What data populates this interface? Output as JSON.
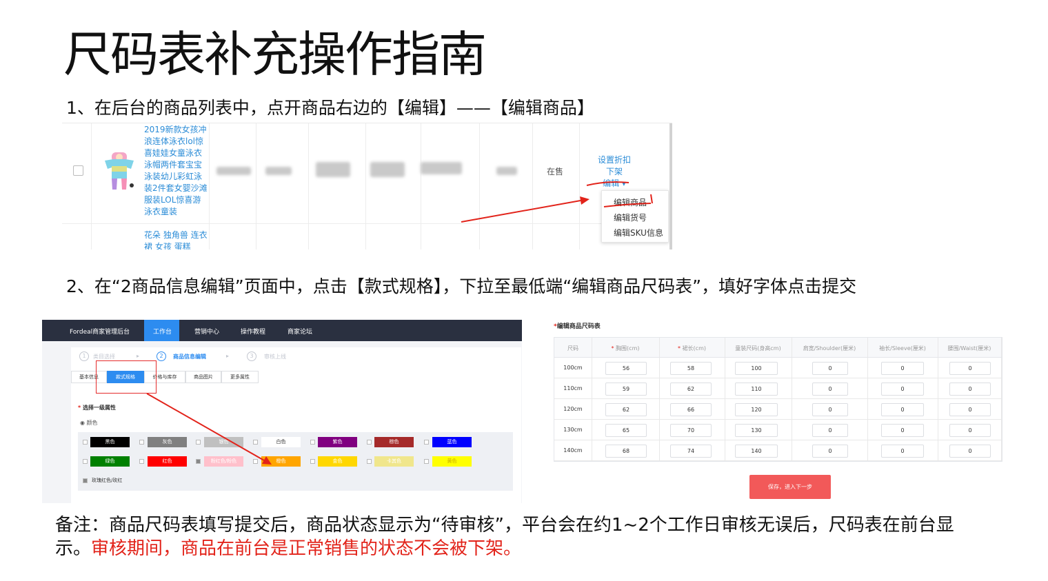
{
  "slide": {
    "title": "尺码表补充操作指南",
    "step1": "1、在后台的商品列表中，点开商品右边的【编辑】——【编辑商品】",
    "step2": "2、在“2商品信息编辑”页面中，点击【款式规格】，下拉至最低端“编辑商品尺码表”，填好字体点击提交",
    "note_main": "备注：商品尺码表填写提交后，商品状态显示为“待审核”，平台会在约1~2个工作日审核无误后，尺码表在前台显示。",
    "note_red": "审核期间，商品在前台是正常销售的状态不会被下架。"
  },
  "product_list": {
    "product_name": "2019新款女孩冲浪连体泳衣lol惊喜娃娃女童泳衣泳帽两件套宝宝泳装幼儿彩虹泳装2件套女婴沙滩服装LOL惊喜游泳衣童装",
    "product_name_2": "花朵 独角兽 连衣裙 女孩 蛋糕",
    "status": "在售",
    "ops": [
      "设置折扣",
      "下架",
      "编辑 ▾"
    ],
    "dropdown": [
      "编辑商品",
      "编辑货号",
      "编辑SKU信息"
    ]
  },
  "editor": {
    "brand": "Fordeal商家管理后台",
    "nav": [
      "工作台",
      "营销中心",
      "操作教程",
      "商家论坛"
    ],
    "steps": [
      {
        "num": "1",
        "label": "类目选择"
      },
      {
        "num": "2",
        "label": "商品信息编辑"
      },
      {
        "num": "3",
        "label": "审核上线"
      }
    ],
    "tabs": [
      "基本信息",
      "款式规格",
      "价格与库存",
      "商品图片",
      "更多属性"
    ],
    "section_label": "选择一级属性",
    "radio_label": "颜色",
    "colors": [
      {
        "name": "黑色",
        "hex": "#000000"
      },
      {
        "name": "灰色",
        "hex": "#808080"
      },
      {
        "name": "银色",
        "hex": "#c0c0c0"
      },
      {
        "name": "白色",
        "hex": "#ffffff"
      },
      {
        "name": "紫色",
        "hex": "#800080"
      },
      {
        "name": "棕色",
        "hex": "#a52a2a"
      },
      {
        "name": "蓝色",
        "hex": "#0000ff"
      },
      {
        "name": "绿色",
        "hex": "#008000"
      },
      {
        "name": "红色",
        "hex": "#ff0000"
      },
      {
        "name": "粉红色/粉色",
        "hex": "#ffc0cb"
      },
      {
        "name": "橙色",
        "hex": "#ffa500"
      },
      {
        "name": "金色",
        "hex": "#ffd700"
      },
      {
        "name": "卡其色",
        "hex": "#f0e68c"
      },
      {
        "name": "黄色",
        "hex": "#ffff00"
      }
    ],
    "extra_color": "玫瑰红色/玫红"
  },
  "size_table": {
    "label": "编辑商品尺码表",
    "headers": [
      "尺码",
      "胸围(cm)",
      "裙长(cm)",
      "童装尺码(身高cm)",
      "肩宽/Shoulder(厘米)",
      "袖长/Sleeve(厘米)",
      "腰围/Waist(厘米)"
    ],
    "required": [
      false,
      true,
      true,
      false,
      false,
      false,
      false
    ],
    "rows": [
      [
        "100cm",
        "56",
        "58",
        "100",
        "0",
        "0",
        "0"
      ],
      [
        "110cm",
        "59",
        "62",
        "110",
        "0",
        "0",
        "0"
      ],
      [
        "120cm",
        "62",
        "66",
        "120",
        "0",
        "0",
        "0"
      ],
      [
        "130cm",
        "65",
        "70",
        "130",
        "0",
        "0",
        "0"
      ],
      [
        "140cm",
        "68",
        "74",
        "140",
        "0",
        "0",
        "0"
      ]
    ],
    "save_button": "保存，进入下一步"
  },
  "colors": {
    "link": "#2b8cd7",
    "accent_blue": "#2d8cf0",
    "annotation_red": "#e2231a",
    "save_button": "#f25959",
    "topbar": "#2a3040"
  }
}
